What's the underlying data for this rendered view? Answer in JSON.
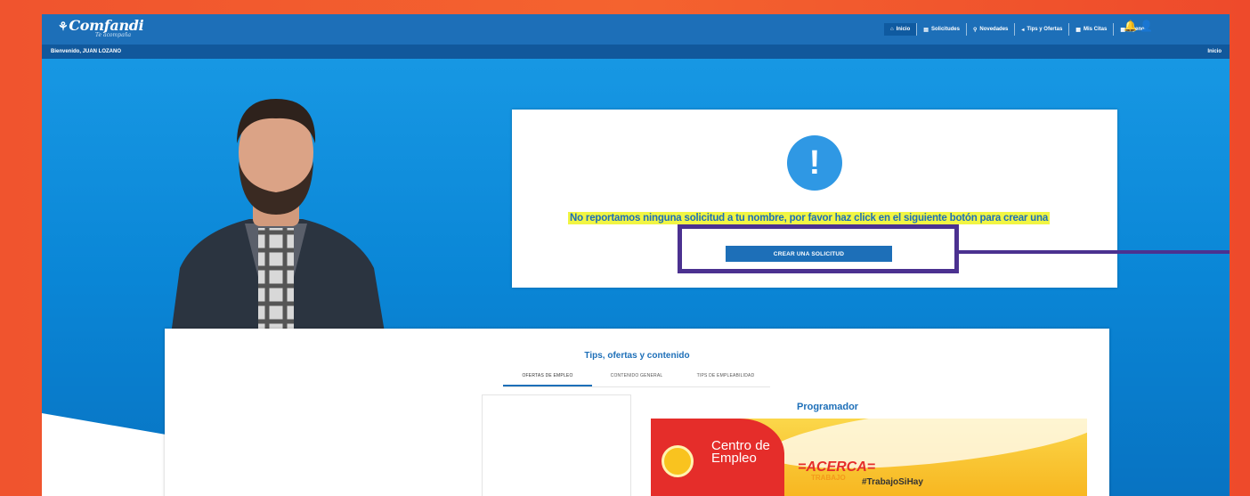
{
  "brand": {
    "logo_text": "Comfandi",
    "tagline": "Te acompaña",
    "accent": "#1d6fb8",
    "highlight": "#f1f543",
    "annotation": "#4b3190"
  },
  "nav": {
    "items": [
      {
        "icon": "home-icon",
        "glyph": "⌂",
        "label": "Inicio"
      },
      {
        "icon": "document-icon",
        "glyph": "▤",
        "label": "Solicitudes"
      },
      {
        "icon": "pin-icon",
        "glyph": "⚲",
        "label": "Novedades"
      },
      {
        "icon": "megaphone-icon",
        "glyph": "◂",
        "label": "Tips y Ofertas"
      },
      {
        "icon": "calendar-icon",
        "glyph": "▦",
        "label": "Mis Citas"
      },
      {
        "icon": "calendar-icon",
        "glyph": "▦",
        "label": "Agenda"
      }
    ],
    "bell_glyph": "🔔",
    "user_glyph": "👤"
  },
  "subbar": {
    "welcome": "Bienvenido, JUAN LOZANO",
    "breadcrumb": "Inicio"
  },
  "alert": {
    "icon_glyph": "!",
    "message": "No reportamos ninguna solicitud a tu nombre, por favor haz click en el siguiente botón para crear una",
    "button_label": "CREAR UNA SOLICITUD"
  },
  "tips": {
    "title": "Tips, ofertas y contenido",
    "tabs": [
      "OFERTAS DE EMPLEO",
      "CONTENIDO GENERAL",
      "TIPS DE EMPLEABILIDAD"
    ],
    "job_title": "Programador",
    "banner": {
      "center_line1": "Centro de",
      "center_line2": "Empleo",
      "acerca": "=ACERCA=",
      "trabajo": "TRABAJO",
      "hashtag": "#TrabajoSiHay"
    }
  }
}
